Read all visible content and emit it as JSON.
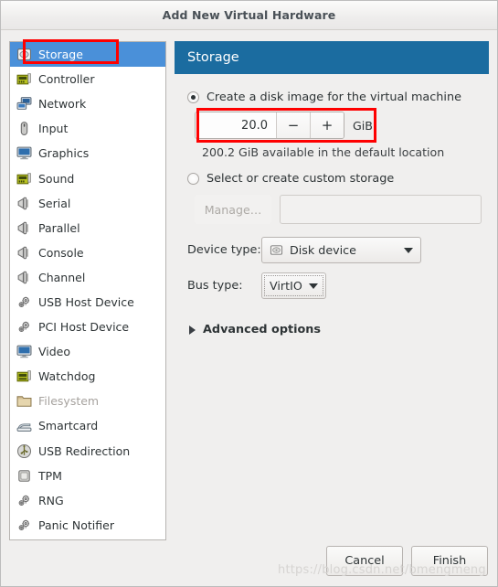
{
  "window": {
    "title": "Add New Virtual Hardware"
  },
  "sidebar": {
    "items": [
      {
        "label": "Storage",
        "icon": "disk-icon",
        "selected": true,
        "disabled": false
      },
      {
        "label": "Controller",
        "icon": "controller-card-icon",
        "selected": false,
        "disabled": false
      },
      {
        "label": "Network",
        "icon": "network-icon",
        "selected": false,
        "disabled": false
      },
      {
        "label": "Input",
        "icon": "mouse-icon",
        "selected": false,
        "disabled": false
      },
      {
        "label": "Graphics",
        "icon": "monitor-icon",
        "selected": false,
        "disabled": false
      },
      {
        "label": "Sound",
        "icon": "sound-card-icon",
        "selected": false,
        "disabled": false
      },
      {
        "label": "Serial",
        "icon": "plug-icon",
        "selected": false,
        "disabled": false
      },
      {
        "label": "Parallel",
        "icon": "plug-icon",
        "selected": false,
        "disabled": false
      },
      {
        "label": "Console",
        "icon": "plug-icon",
        "selected": false,
        "disabled": false
      },
      {
        "label": "Channel",
        "icon": "plug-icon",
        "selected": false,
        "disabled": false
      },
      {
        "label": "USB Host Device",
        "icon": "gears-icon",
        "selected": false,
        "disabled": false
      },
      {
        "label": "PCI Host Device",
        "icon": "gears-icon",
        "selected": false,
        "disabled": false
      },
      {
        "label": "Video",
        "icon": "monitor-icon",
        "selected": false,
        "disabled": false
      },
      {
        "label": "Watchdog",
        "icon": "watchdog-card-icon",
        "selected": false,
        "disabled": false
      },
      {
        "label": "Filesystem",
        "icon": "folder-icon",
        "selected": false,
        "disabled": true
      },
      {
        "label": "Smartcard",
        "icon": "smartcard-reader-icon",
        "selected": false,
        "disabled": false
      },
      {
        "label": "USB Redirection",
        "icon": "usb-icon",
        "selected": false,
        "disabled": false
      },
      {
        "label": "TPM",
        "icon": "chip-icon",
        "selected": false,
        "disabled": false
      },
      {
        "label": "RNG",
        "icon": "gears-icon",
        "selected": false,
        "disabled": false
      },
      {
        "label": "Panic Notifier",
        "icon": "gears-icon",
        "selected": false,
        "disabled": false
      }
    ]
  },
  "panel": {
    "header_title": "Storage",
    "option_create": {
      "label": "Create a disk image for the virtual machine",
      "selected": true
    },
    "spin": {
      "value": "20.0",
      "minus_label": "−",
      "plus_label": "+",
      "unit": "GiB"
    },
    "available_text": "200.2 GiB available in the default location",
    "option_custom": {
      "label": "Select or create custom storage",
      "selected": false
    },
    "manage_button": "Manage…",
    "path_field_value": "",
    "device_type": {
      "label": "Device type:",
      "value": "Disk device",
      "icon": "disk-icon"
    },
    "bus_type": {
      "label": "Bus type:",
      "value": "VirtIO"
    },
    "advanced_options": "Advanced options"
  },
  "footer": {
    "cancel": "Cancel",
    "finish": "Finish"
  },
  "watermark": "https://blog.csdn.net/bmengmeng",
  "colors": {
    "header_blue": "#1b6ca0",
    "selection_blue": "#4a90d9",
    "annotation_red": "#fe0000",
    "background": "#f0efee"
  }
}
